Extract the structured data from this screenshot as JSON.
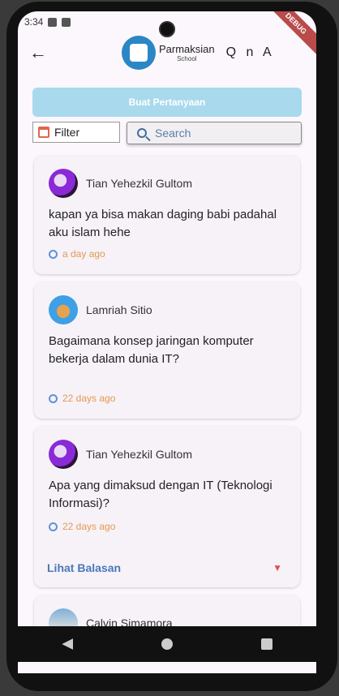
{
  "status": {
    "time": "3:34",
    "debug_label": "DEBUG"
  },
  "appbar": {
    "brand": "Parmaksian",
    "brand_sub": "School",
    "title": "Q n A"
  },
  "actions": {
    "ask_label": "Buat Pertanyaan",
    "filter_label": "Filter",
    "search_placeholder": "Search"
  },
  "posts": [
    {
      "author": "Tian Yehezkil Gultom",
      "question": "kapan ya bisa makan daging babi padahal aku islam hehe",
      "time": "a day ago"
    },
    {
      "author": "Lamriah Sitio",
      "question": "Bagaimana konsep jaringan komputer bekerja dalam dunia IT?",
      "time": "22 days ago"
    },
    {
      "author": "Tian Yehezkil Gultom",
      "question": "Apa yang dimaksud dengan IT (Teknologi Informasi)?",
      "time": "22 days ago",
      "replies_label": "Lihat Balasan"
    },
    {
      "author": "Calvin Simamora"
    }
  ],
  "colors": {
    "accent": "#4a78b8",
    "button": "#a9d9ec",
    "time": "#e19a52"
  },
  "icons": [
    "back-icon",
    "calendar-icon",
    "search-icon",
    "clock-icon",
    "chevron-down-icon"
  ]
}
